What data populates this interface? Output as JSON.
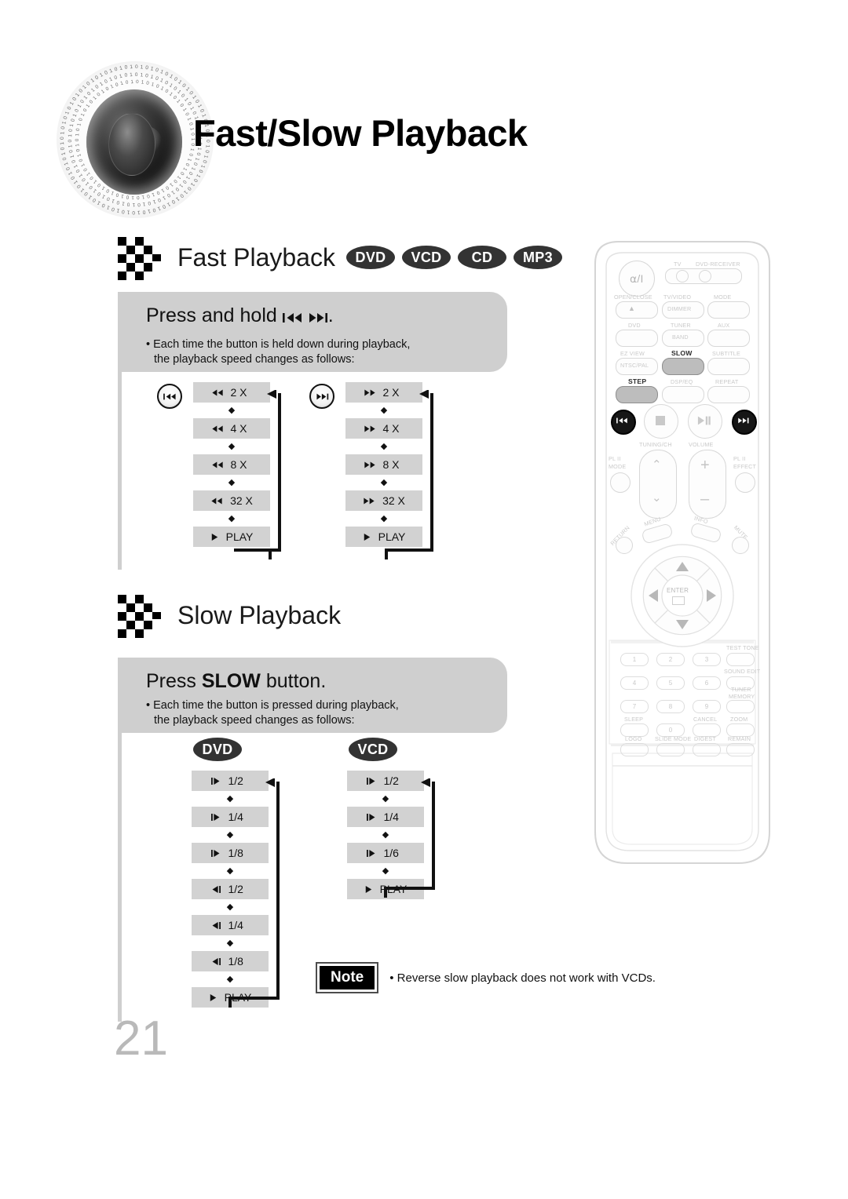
{
  "page": {
    "title": "Fast/Slow Playback",
    "number": "21"
  },
  "fast_section": {
    "heading": "Fast Playback",
    "badges": [
      "DVD",
      "VCD",
      "CD",
      "MP3"
    ],
    "panel_title_prefix": "Press and hold",
    "panel_title_glyphs": "|◀◀  ▶▶|",
    "panel_title_suffix": ".",
    "bullet_line1": "• Each time the button is held down during playback,",
    "bullet_line2": "the playback speed changes as follows:",
    "flows": [
      {
        "button_icon": "skip-back-icon",
        "direction": "reverse",
        "steps": [
          {
            "glyph": "rewind",
            "label": "2 X"
          },
          {
            "glyph": "rewind",
            "label": "4 X"
          },
          {
            "glyph": "rewind",
            "label": "8 X"
          },
          {
            "glyph": "rewind",
            "label": "32 X"
          },
          {
            "glyph": "play",
            "label": "PLAY"
          }
        ]
      },
      {
        "button_icon": "skip-forward-icon",
        "direction": "forward",
        "steps": [
          {
            "glyph": "fastforward",
            "label": "2 X"
          },
          {
            "glyph": "fastforward",
            "label": "4 X"
          },
          {
            "glyph": "fastforward",
            "label": "8 X"
          },
          {
            "glyph": "fastforward",
            "label": "32 X"
          },
          {
            "glyph": "play",
            "label": "PLAY"
          }
        ]
      }
    ]
  },
  "slow_section": {
    "heading": "Slow Playback",
    "panel_title_prefix": "Press",
    "panel_title_bold": "SLOW",
    "panel_title_suffix": "button.",
    "bullet_line1": "• Each time the button is pressed during playback,",
    "bullet_line2": "the playback speed changes as follows:",
    "flows": [
      {
        "badge": "DVD",
        "steps": [
          {
            "glyph": "slow-forward",
            "label": "1/2"
          },
          {
            "glyph": "slow-forward",
            "label": "1/4"
          },
          {
            "glyph": "slow-forward",
            "label": "1/8"
          },
          {
            "glyph": "slow-reverse",
            "label": "1/2"
          },
          {
            "glyph": "slow-reverse",
            "label": "1/4"
          },
          {
            "glyph": "slow-reverse",
            "label": "1/8"
          },
          {
            "glyph": "play",
            "label": "PLAY"
          }
        ]
      },
      {
        "badge": "VCD",
        "steps": [
          {
            "glyph": "slow-forward",
            "label": "1/2"
          },
          {
            "glyph": "slow-forward",
            "label": "1/4"
          },
          {
            "glyph": "slow-forward",
            "label": "1/6"
          },
          {
            "glyph": "play",
            "label": "PLAY"
          }
        ]
      }
    ]
  },
  "note": {
    "tag": "Note",
    "text": "• Reverse slow playback does not work with VCDs."
  },
  "remote": {
    "labels": {
      "tv": "TV",
      "dvd_receiver": "DVD-RECEIVER",
      "open_close": "OPEN/CLOSE",
      "tv_video": "TV/VIDEO",
      "dimmer": "DIMMER",
      "mode": "MODE",
      "dvd": "DVD",
      "tuner": "TUNER",
      "band": "BAND",
      "aux": "AUX",
      "ez_view": "EZ VIEW",
      "ntsc_pal": "NTSC/PAL",
      "slow": "SLOW",
      "subtitle": "SUBTITLE",
      "step": "STEP",
      "dsp_eq": "DSP/EQ",
      "repeat": "REPEAT",
      "tuning_ch": "TUNING/CH",
      "volume": "VOLUME",
      "pl2_mode_1": "PL II",
      "pl2_mode_2": "MODE",
      "pl2_effect_1": "PL II",
      "pl2_effect_2": "EFFECT",
      "menu": "MENU",
      "info": "INFO",
      "return": "RETURN",
      "mute": "MUTE",
      "enter": "ENTER",
      "test_tone": "TEST TONE",
      "sound_edit": "SOUND EDIT",
      "tuner_memory_1": "TUNER",
      "tuner_memory_2": "MEMORY",
      "sleep": "SLEEP",
      "cancel": "CANCEL",
      "zoom": "ZOOM",
      "logo": "LOGO",
      "slide_mode": "SLIDE MODE",
      "digest": "DIGEST",
      "remain": "REMAIN"
    },
    "keypad": [
      "1",
      "2",
      "3",
      "4",
      "5",
      "6",
      "7",
      "8",
      "9",
      "0"
    ],
    "highlighted": [
      "SLOW",
      "STEP",
      "skip-back",
      "skip-forward"
    ]
  },
  "colors": {
    "panel_gray": "#cfcfcf",
    "step_gray": "#d2d2d2",
    "badge_dark": "#333333",
    "page_number_gray": "#b9b9b9"
  }
}
